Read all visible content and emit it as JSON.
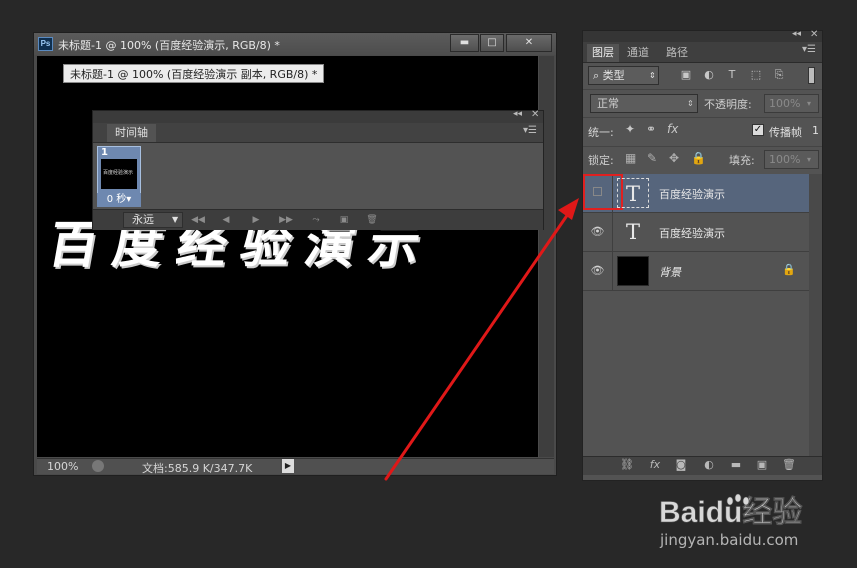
{
  "document": {
    "title": "未标题-1 @ 100% (百度经验演示, RGB/8) *",
    "tooltip": "未标题-1 @ 100% (百度经验演示 副本, RGB/8) *",
    "canvas_text": "百度经验演示",
    "app_icon_label": "Ps",
    "window_buttons": {
      "minimize": "▬",
      "maximize": "□",
      "close": "✕"
    },
    "status": {
      "zoom": "100%",
      "doc_info": "文档:585.9 K/347.7K",
      "arrow": "▶"
    }
  },
  "timeline": {
    "tab_label": "时间轴",
    "frame": {
      "number": "1",
      "delay": "0 秒▾",
      "thumb_text": "百度经验演示"
    },
    "loop_option": "永远",
    "controls": [
      "◀◀",
      "◀",
      "▶",
      "▶▶",
      "⤳",
      "▣",
      "🗑"
    ]
  },
  "layers_panel": {
    "tabs": [
      "图层",
      "通道",
      "路径"
    ],
    "filter_kind": "类型",
    "blend_mode": "正常",
    "opacity_label": "不透明度:",
    "opacity_value": "100%",
    "unify_label": "统一:",
    "propagate_label": "传播帧",
    "propagate_value": "1",
    "lock_label": "锁定:",
    "fill_label": "填充:",
    "fill_value": "100%",
    "layers": [
      {
        "name": "百度经验演示",
        "type": "text",
        "visible": false,
        "selected": true
      },
      {
        "name": "百度经验演示",
        "type": "text",
        "visible": true,
        "selected": false
      },
      {
        "name": "背景",
        "type": "background",
        "visible": true,
        "locked": true
      }
    ]
  },
  "watermark": {
    "logo_text": "Baidu经验",
    "url": "jingyan.baidu.com"
  },
  "colors": {
    "selected_layer": "#56657c",
    "highlight_box": "#e02020",
    "arrow": "#e01818"
  }
}
